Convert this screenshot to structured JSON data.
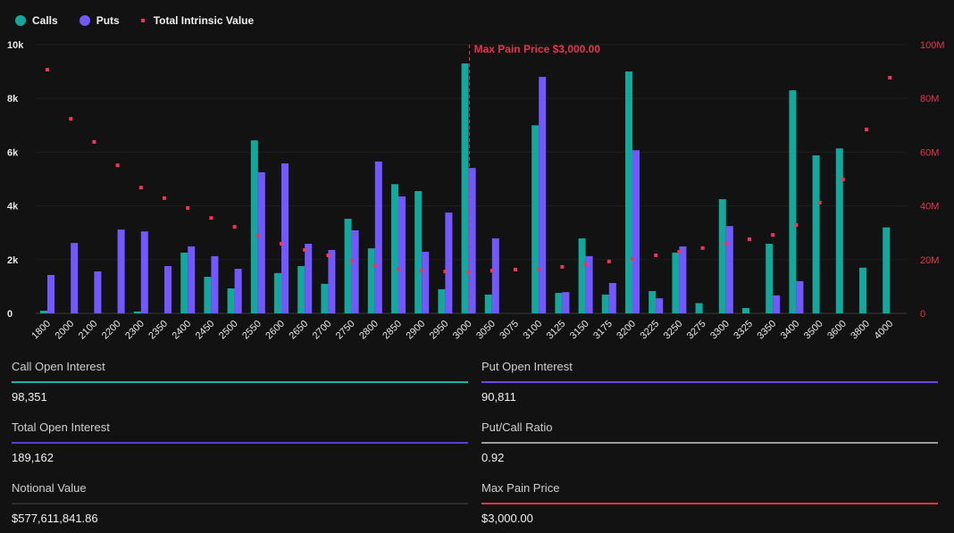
{
  "legend": {
    "calls": "Calls",
    "puts": "Puts",
    "intrinsic": "Total Intrinsic Value"
  },
  "colors": {
    "calls": "#13a89b",
    "puts": "#7357ff",
    "intrinsic": "#f0355a",
    "background": "#121212"
  },
  "chart_data": {
    "type": "bar",
    "categories": [
      "1800",
      "2000",
      "2100",
      "2200",
      "2300",
      "2350",
      "2400",
      "2450",
      "2500",
      "2550",
      "2600",
      "2650",
      "2700",
      "2750",
      "2800",
      "2850",
      "2900",
      "2950",
      "3000",
      "3050",
      "3075",
      "3100",
      "3125",
      "3150",
      "3175",
      "3200",
      "3225",
      "3250",
      "3275",
      "3300",
      "3325",
      "3350",
      "3400",
      "3500",
      "3600",
      "3800",
      "4000"
    ],
    "series": [
      {
        "name": "Calls",
        "type": "bar",
        "axis": "left",
        "values": [
          100,
          0,
          0,
          0,
          70,
          0,
          2260,
          1360,
          930,
          6440,
          1500,
          1760,
          1100,
          3520,
          2420,
          4810,
          4550,
          900,
          9300,
          700,
          0,
          7000,
          760,
          2790,
          700,
          9000,
          830,
          2260,
          380,
          4250,
          200,
          2590,
          8300,
          5880,
          6140,
          1700,
          3200
        ]
      },
      {
        "name": "Puts",
        "type": "bar",
        "axis": "left",
        "values": [
          1430,
          2620,
          1560,
          3120,
          3050,
          1760,
          2490,
          2130,
          1660,
          5250,
          5580,
          2590,
          2360,
          3090,
          5650,
          4350,
          2290,
          3750,
          5410,
          2790,
          0,
          8800,
          790,
          2130,
          1130,
          6070,
          560,
          2490,
          0,
          3250,
          0,
          670,
          1200,
          0,
          0,
          0,
          0
        ]
      },
      {
        "name": "Total Intrinsic Value",
        "type": "scatter",
        "axis": "right",
        "values": [
          90.7,
          72.4,
          63.8,
          55.1,
          46.8,
          42.9,
          39.2,
          35.5,
          32.2,
          28.9,
          25.9,
          23.6,
          21.6,
          19.6,
          17.9,
          16.6,
          15.9,
          15.6,
          15.3,
          15.9,
          16.3,
          16.6,
          17.3,
          18.3,
          19.3,
          20.3,
          21.6,
          22.9,
          24.3,
          25.9,
          27.6,
          29.2,
          32.9,
          41.2,
          49.8,
          68.4,
          87.7
        ],
        "unit": "M"
      }
    ],
    "left_axis": {
      "ylim": [
        0,
        10000
      ],
      "ticks": [
        "0",
        "2k",
        "4k",
        "6k",
        "8k",
        "10k"
      ]
    },
    "right_axis": {
      "ylim": [
        0,
        100
      ],
      "ticks": [
        "0",
        "20M",
        "40M",
        "60M",
        "80M",
        "100M"
      ]
    },
    "grid": true,
    "legend_position": "top-left",
    "annotation": {
      "x": "3000",
      "label": "Max Pain Price $3,000.00"
    }
  },
  "stats": [
    {
      "label": "Call Open Interest",
      "value": "98,351",
      "color": "#13b5a6"
    },
    {
      "label": "Put Open Interest",
      "value": "90,811",
      "color": "#6a48e6"
    },
    {
      "label": "Total Open Interest",
      "value": "189,162",
      "color": "#5a3fd8"
    },
    {
      "label": "Put/Call Ratio",
      "value": "0.92",
      "color": "#9a9a9a"
    },
    {
      "label": "Notional Value",
      "value": "$577,611,841.86",
      "color": "#2c2c2c"
    },
    {
      "label": "Max Pain Price",
      "value": "$3,000.00",
      "color": "#e8334f"
    }
  ]
}
